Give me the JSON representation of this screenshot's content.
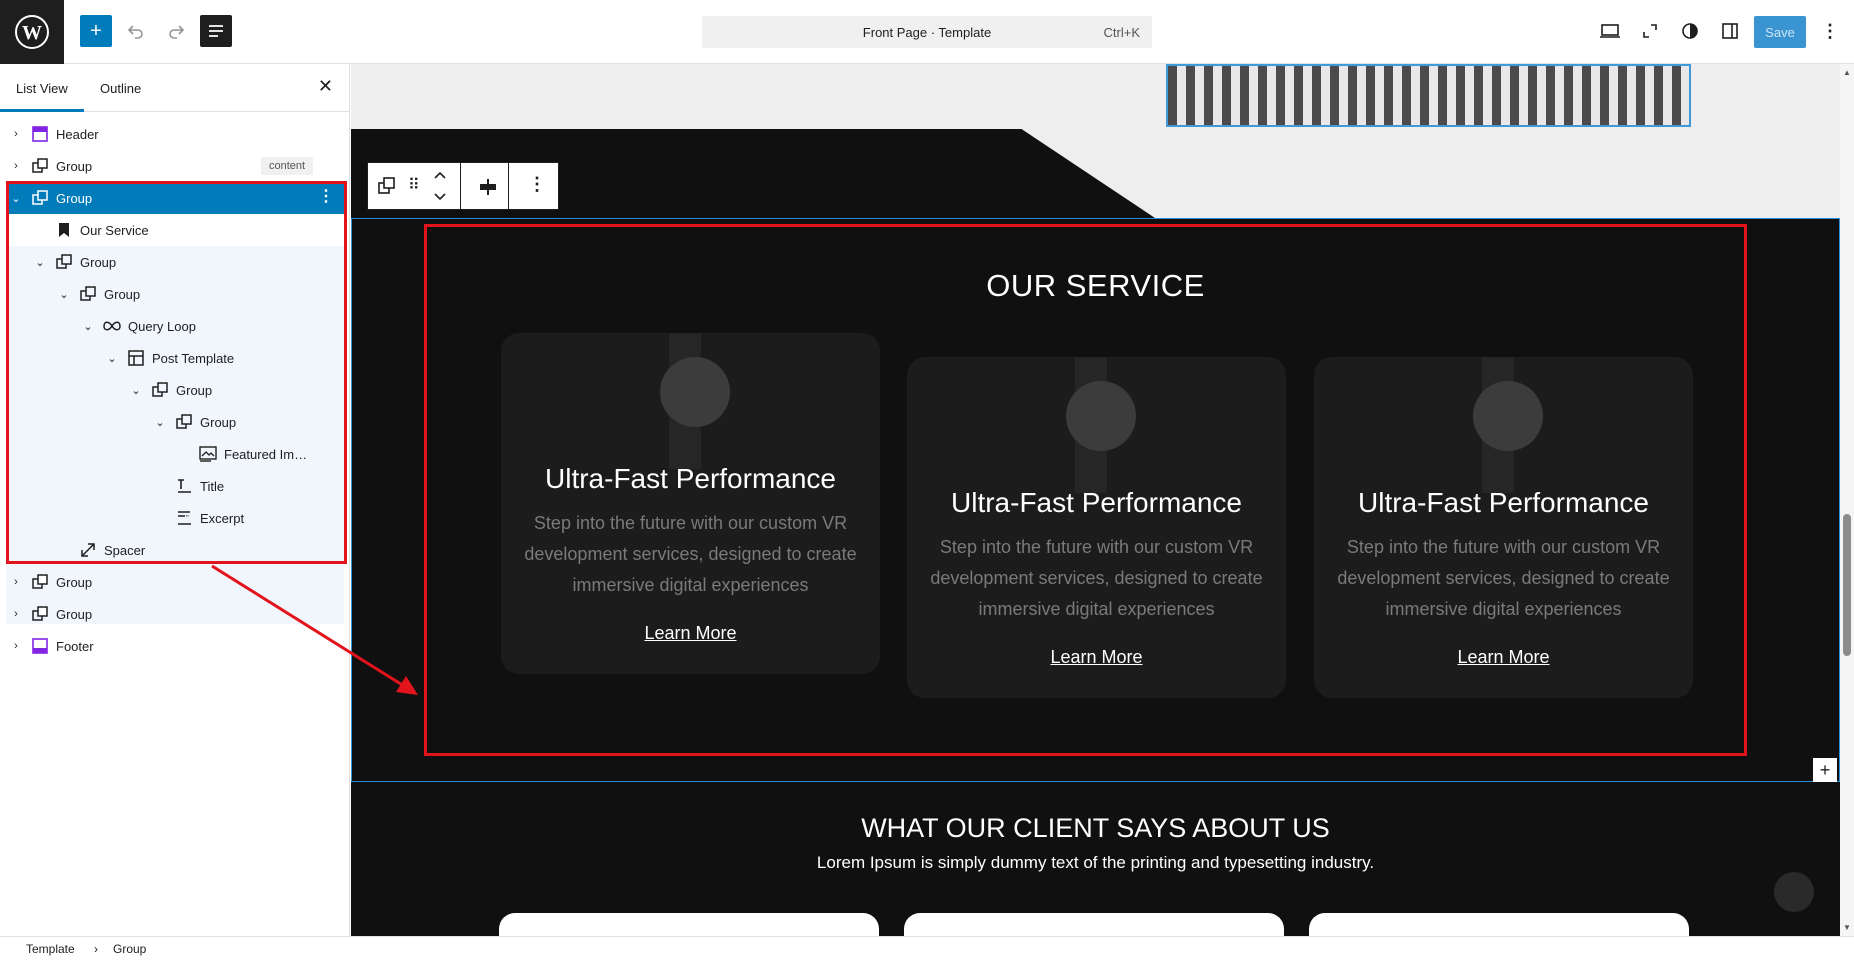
{
  "topbar": {
    "command_title": "Front Page · Template",
    "shortcut": "Ctrl+K",
    "save_label": "Save"
  },
  "sidebar": {
    "tab_list_view": "List View",
    "tab_outline": "Outline",
    "content_badge": "content",
    "items": [
      {
        "label": "Header"
      },
      {
        "label": "Group"
      },
      {
        "label": "Group"
      },
      {
        "label": "Our Service"
      },
      {
        "label": "Group"
      },
      {
        "label": "Group"
      },
      {
        "label": "Query Loop"
      },
      {
        "label": "Post Template"
      },
      {
        "label": "Group"
      },
      {
        "label": "Group"
      },
      {
        "label": "Featured Im…"
      },
      {
        "label": "Title"
      },
      {
        "label": "Excerpt"
      },
      {
        "label": "Spacer"
      },
      {
        "label": "Group"
      },
      {
        "label": "Group"
      },
      {
        "label": "Footer"
      }
    ]
  },
  "canvas": {
    "service_title": "OUR SERVICE",
    "cards": [
      {
        "title": "Ultra-Fast Performance",
        "text": "Step into the future with our custom VR development services, designed to create immersive digital experiences",
        "link": "Learn More"
      },
      {
        "title": "Ultra-Fast Performance",
        "text": "Step into the future with our custom VR development services, designed to create immersive digital experiences",
        "link": "Learn More"
      },
      {
        "title": "Ultra-Fast Performance",
        "text": "Step into the future with our custom VR development services, designed to create immersive digital experiences",
        "link": "Learn More"
      }
    ],
    "testimonial_title": "WHAT OUR CLIENT SAYS ABOUT US",
    "testimonial_sub": "Lorem Ipsum is simply dummy text of the printing and typesetting industry."
  },
  "breadcrumb": {
    "root": "Template",
    "current": "Group"
  },
  "colors": {
    "accent": "#007cba",
    "highlight": "#e3131b",
    "dark_bg": "#101010",
    "card_bg": "#1c1c1c"
  }
}
